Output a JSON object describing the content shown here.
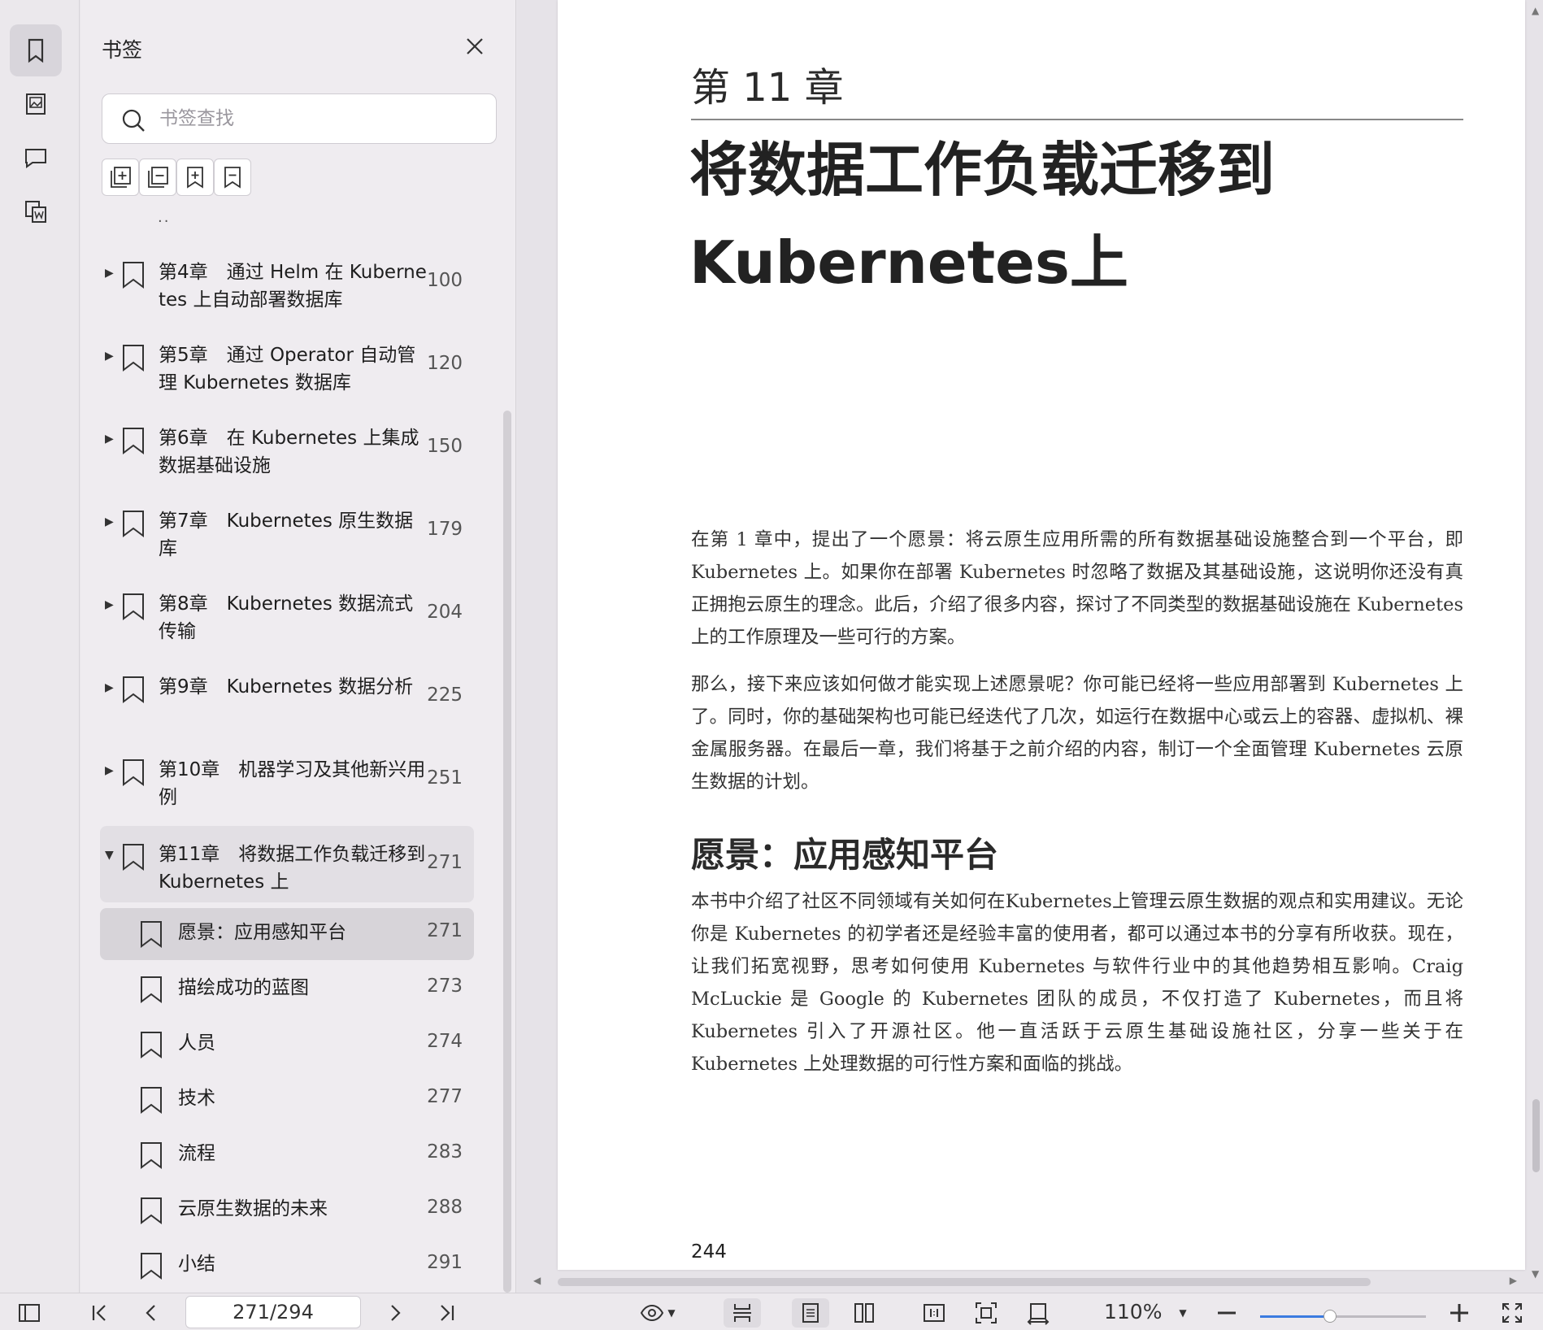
{
  "sidebar_panel": {
    "title": "书签",
    "search_placeholder": "书签查找",
    "bookmarks": [
      {
        "label": "第4章　通过 Helm 在 Kubernetes 上自动部署数据库",
        "page": "100",
        "expanded": false
      },
      {
        "label": "第5章　通过 Operator 自动管理 Kubernetes 数据库",
        "page": "120",
        "expanded": false
      },
      {
        "label": "第6章　在 Kubernetes 上集成数据基础设施",
        "page": "150",
        "expanded": false
      },
      {
        "label": "第7章　Kubernetes 原生数据库",
        "page": "179",
        "expanded": false
      },
      {
        "label": "第8章　Kubernetes 数据流式传输",
        "page": "204",
        "expanded": false
      },
      {
        "label": "第9章　Kubernetes 数据分析",
        "page": "225",
        "expanded": false
      },
      {
        "label": "第10章　机器学习及其他新兴用例",
        "page": "251",
        "expanded": false
      },
      {
        "label": "第11章　将数据工作负载迁移到 Kubernetes 上",
        "page": "271",
        "expanded": true
      }
    ],
    "sub_bookmarks": [
      {
        "label": "愿景：应用感知平台",
        "page": "271",
        "selected": true
      },
      {
        "label": "描绘成功的蓝图",
        "page": "273"
      },
      {
        "label": "人员",
        "page": "274"
      },
      {
        "label": "技术",
        "page": "277"
      },
      {
        "label": "流程",
        "page": "283"
      },
      {
        "label": "云原生数据的未来",
        "page": "288"
      },
      {
        "label": "小结",
        "page": "291"
      }
    ]
  },
  "document": {
    "chapter_number": "第 11 章",
    "chapter_title_line1": "将数据工作负载迁移到",
    "chapter_title_line2": "Kubernetes上",
    "paragraph1": "在第 1 章中，提出了一个愿景：将云原生应用所需的所有数据基础设施整合到一个平台，即 Kubernetes 上。如果你在部署 Kubernetes 时忽略了数据及其基础设施，这说明你还没有真正拥抱云原生的理念。此后，介绍了很多内容，探讨了不同类型的数据基础设施在 Kubernetes 上的工作原理及一些可行的方案。",
    "paragraph2": "那么，接下来应该如何做才能实现上述愿景呢？你可能已经将一些应用部署到 Kubernetes 上了。同时，你的基础架构也可能已经迭代了几次，如运行在数据中心或云上的容器、虚拟机、裸金属服务器。在最后一章，我们将基于之前介绍的内容，制订一个全面管理 Kubernetes 云原生数据的计划。",
    "section_heading": "愿景：应用感知平台",
    "paragraph3": "本书中介绍了社区不同领域有关如何在Kubernetes上管理云原生数据的观点和实用建议。无论你是 Kubernetes 的初学者还是经验丰富的使用者，都可以通过本书的分享有所收获。现在，让我们拓宽视野，思考如何使用 Kubernetes 与软件行业中的其他趋势相互影响。Craig McLuckie 是 Google 的 Kubernetes 团队的成员，不仅打造了 Kubernetes，而且将 Kubernetes 引入了开源社区。他一直活跃于云原生基础设施社区，分享一些关于在 Kubernetes 上处理数据的可行性方案和面临的挑战。",
    "page_number": "244"
  },
  "bottom_bar": {
    "page_indicator": "271/294",
    "zoom_level": "110%",
    "zoom_fraction": 0.42
  },
  "colors": {
    "accent": "#3b7be0",
    "panel_bg": "#efecf0",
    "selected_row": "#d7d4d9"
  }
}
